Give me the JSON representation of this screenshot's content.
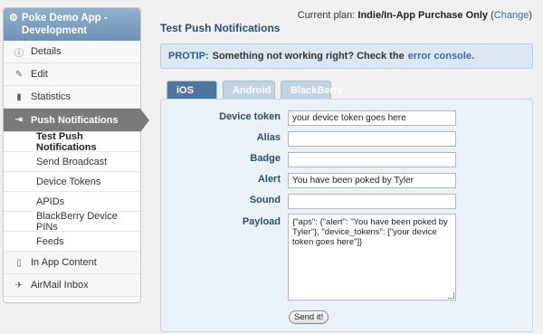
{
  "app": {
    "title": "Poke Demo App - Development"
  },
  "sidebar": {
    "items": [
      {
        "label": "Details",
        "icon": "info-icon"
      },
      {
        "label": "Edit",
        "icon": "pencil-icon"
      },
      {
        "label": "Statistics",
        "icon": "bar-chart-icon"
      },
      {
        "label": "Push Notifications",
        "icon": "push-icon"
      }
    ],
    "subitems": [
      {
        "label": "Test Push Notifications"
      },
      {
        "label": "Send Broadcast"
      },
      {
        "label": "Device Tokens"
      },
      {
        "label": "APIDs"
      },
      {
        "label": "BlackBerry Device PINs"
      },
      {
        "label": "Feeds"
      }
    ],
    "lower": [
      {
        "label": "In App Content",
        "icon": "document-icon"
      },
      {
        "label": "AirMail Inbox",
        "icon": "airmail-icon"
      }
    ]
  },
  "header": {
    "title": "Test Push Notifications",
    "plan_prefix": "Current plan:",
    "plan_name": "Indie/In-App Purchase Only",
    "change_label": "Change"
  },
  "protip": {
    "label": "PROTIP:",
    "text": "Something not working right? Check the",
    "link": "error console."
  },
  "tabs": [
    "iOS",
    "Android",
    "BlackBerry"
  ],
  "form": {
    "device_token_label": "Device token",
    "device_token_value": "your device token goes here",
    "alias_label": "Alias",
    "alias_value": "",
    "badge_label": "Badge",
    "badge_value": "",
    "alert_label": "Alert",
    "alert_value": "You have been poked by Tyler",
    "sound_label": "Sound",
    "sound_value": "",
    "payload_label": "Payload",
    "payload_value": "{\"aps\": {\"alert\": \"You have been poked by Tyler\"}, \"device_tokens\": [\"your device token goes here\"]}",
    "send_label": "Send it!"
  }
}
